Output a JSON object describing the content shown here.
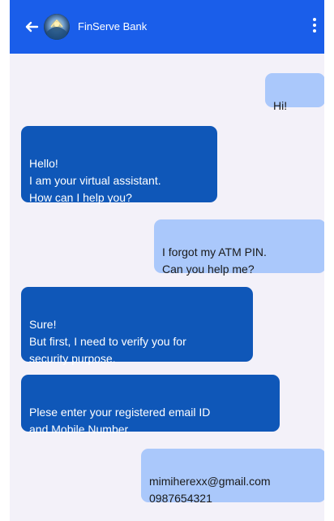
{
  "header": {
    "title": "FinServe Bank",
    "back_icon": "arrow-left-icon",
    "avatar_icon": "bank-logo-avatar",
    "menu_icon": "more-vertical-icon"
  },
  "colors": {
    "header_bg": "#1a5eea",
    "chat_bg": "#f3f1f9",
    "bot_bubble": "#0f57b8",
    "user_bubble": "#aac8fb"
  },
  "messages": [
    {
      "sender": "user",
      "text": "Hi!"
    },
    {
      "sender": "bot",
      "text": "Hello!\nI am your virtual assistant.\nHow can I help you?"
    },
    {
      "sender": "user",
      "text": "I forgot my ATM PIN.\nCan you help me?"
    },
    {
      "sender": "bot",
      "text": "Sure!\nBut first, I need to verify you for\nsecurity purpose."
    },
    {
      "sender": "bot",
      "text": "Plese enter your registered email ID\nand Mobile Number."
    },
    {
      "sender": "user",
      "text": "mimiherexx@gmail.com\n0987654321"
    }
  ]
}
